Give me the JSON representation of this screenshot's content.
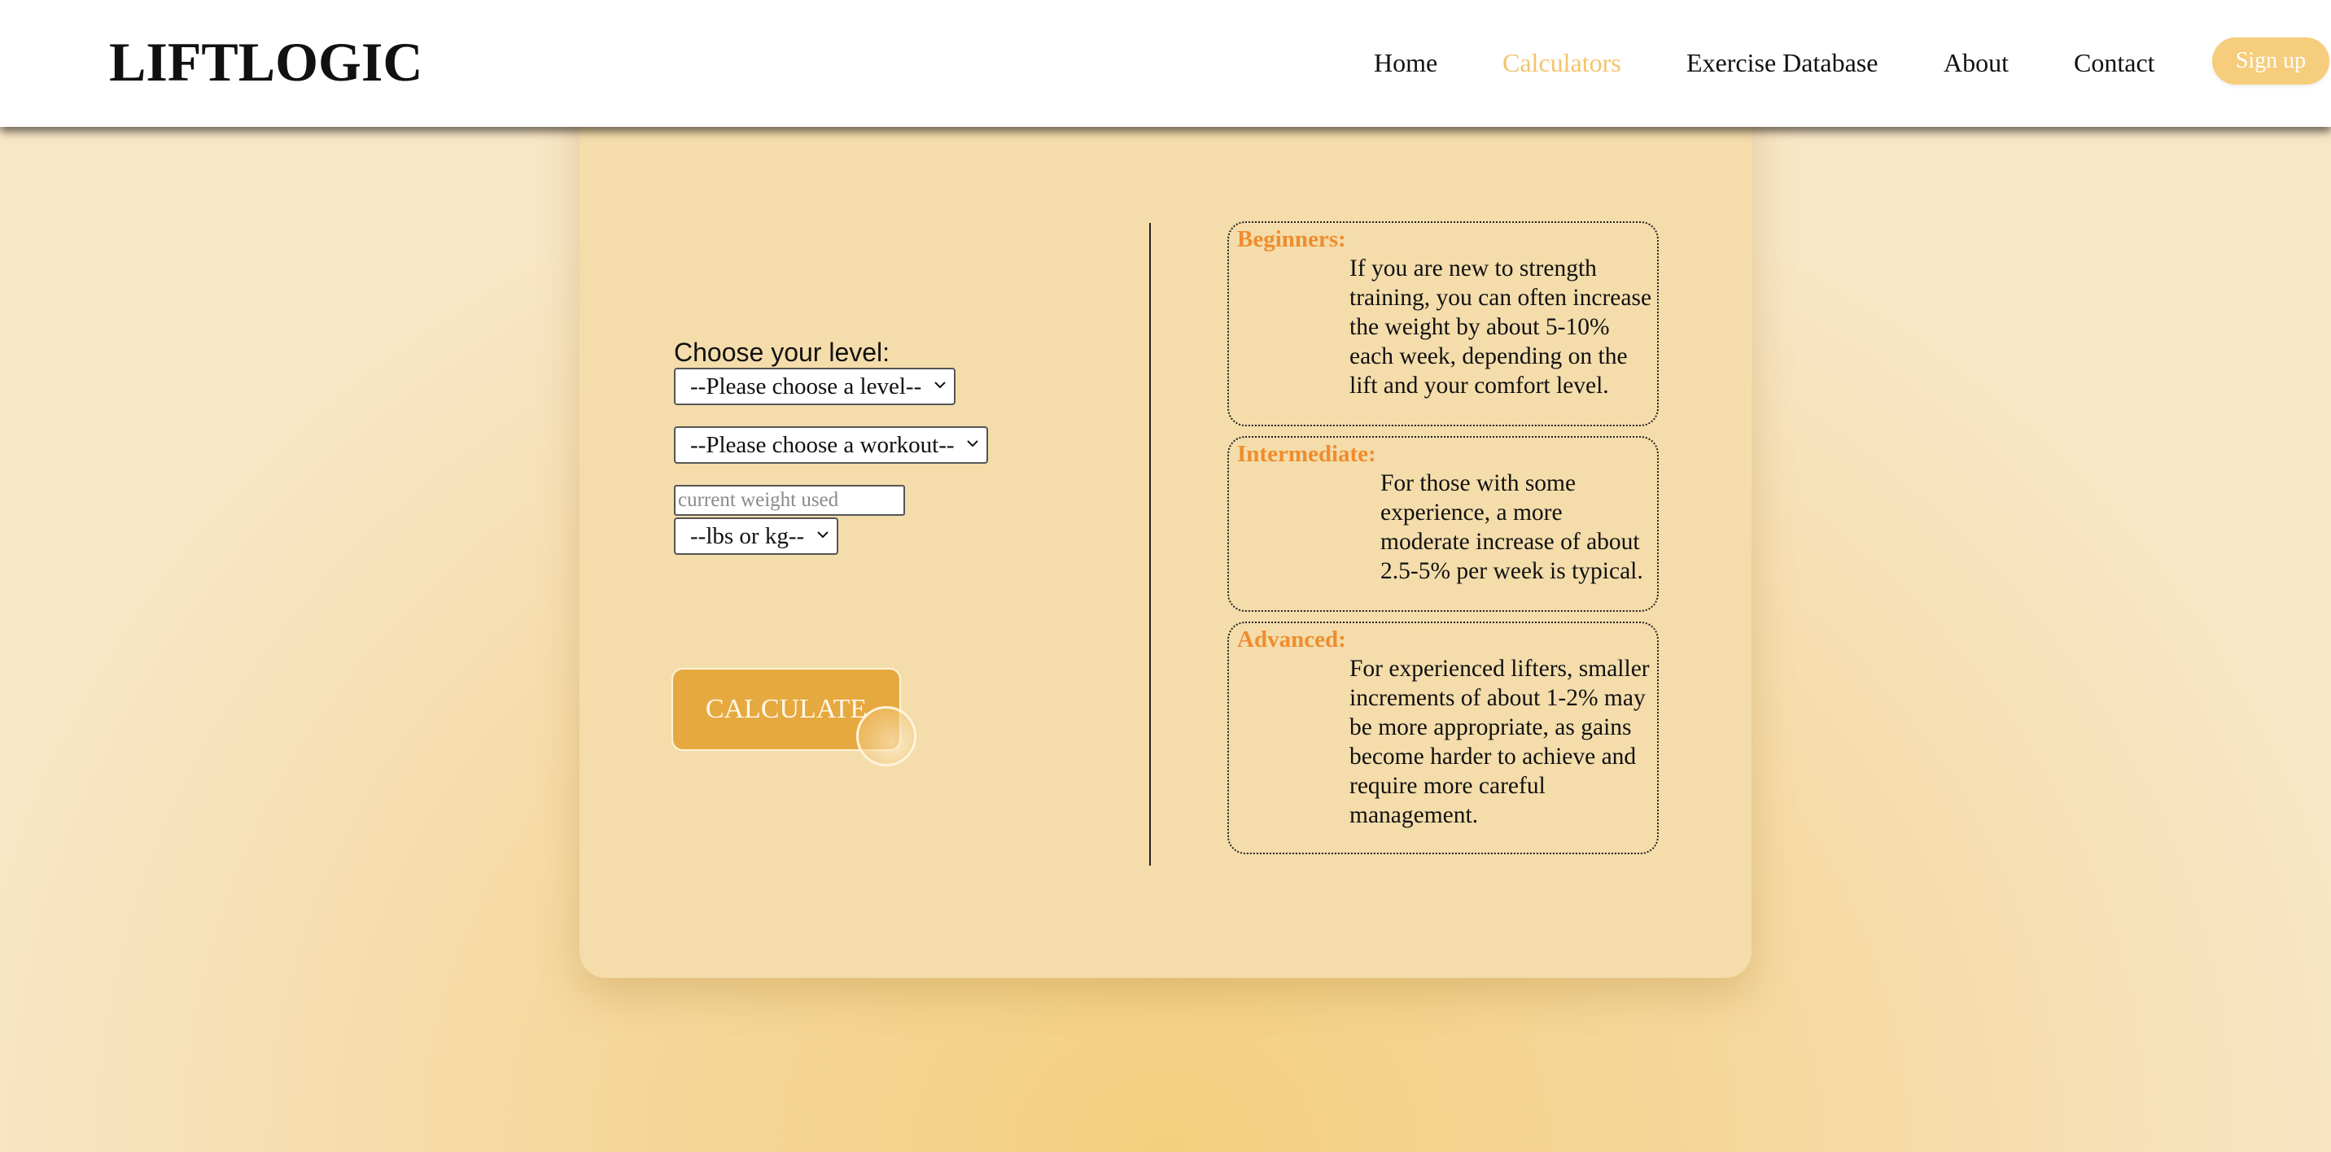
{
  "header": {
    "logo": "LIFTLOGIC",
    "nav": {
      "home": "Home",
      "calculators": "Calculators",
      "exercise_database": "Exercise Database",
      "about": "About",
      "contact": "Contact",
      "active": "Calculators"
    },
    "signup_label": "Sign up"
  },
  "form": {
    "level_label": "Choose your level:",
    "level_select": "--Please choose a level--",
    "workout_select": "--Please choose a workout--",
    "weight_placeholder": "current weight used",
    "unit_select": "--lbs or kg--",
    "calculate_label": "CALCULATE"
  },
  "info": {
    "beginners": {
      "title": "Beginners:",
      "text": "If you are new to strength training, you can often increase the weight by about 5-10% each week, depending on the lift and your comfort level."
    },
    "intermediate": {
      "title": "Intermediate:",
      "text": "For those with some experience, a more moderate increase of about 2.5-5% per week is typical."
    },
    "advanced": {
      "title": "Advanced:",
      "text": "For experienced lifters, smaller increments of about 1-2% may be more appropriate, as gains become harder to achieve and require more careful management."
    }
  },
  "colors": {
    "accent": "#f3c46d",
    "button": "#e6a93f",
    "title_orange": "#f08c2e",
    "card": "#f4ddab"
  },
  "icons": {
    "select_arrow": "chevron-down-icon"
  }
}
